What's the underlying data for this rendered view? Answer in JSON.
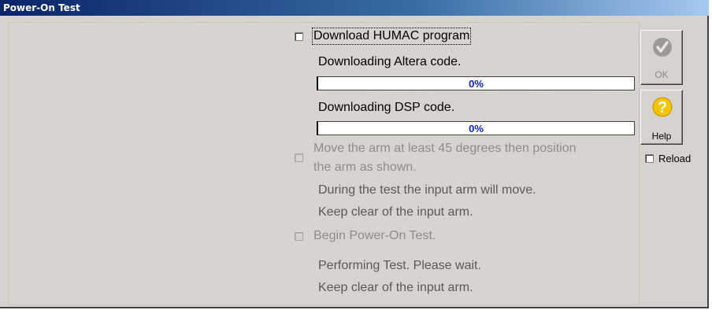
{
  "window": {
    "title": "Power-On Test"
  },
  "steps": {
    "download": {
      "checkbox_label": "Download HUMAC program",
      "altera_label": "Downloading Altera code.",
      "altera_progress": "0%",
      "altera_progress_value": 0,
      "dsp_label": "Downloading DSP code.",
      "dsp_progress": "0%",
      "dsp_progress_value": 0
    },
    "position": {
      "label_line1": "Move the arm at least 45 degrees then position",
      "label_line2": "the arm as shown.",
      "info_line1": "During the test the input arm will move.",
      "info_line2": "Keep clear of the input arm."
    },
    "begin": {
      "label": "Begin Power-On Test.",
      "info_line1": "Performing Test. Please wait.",
      "info_line2": "Keep clear of the input arm."
    }
  },
  "buttons": {
    "ok_label": "OK",
    "help_label": "Help",
    "reload_label": "Reload"
  },
  "colors": {
    "titlebar": "#0a246a",
    "progress_text": "#0a1dbe",
    "help_icon": "#f5c400"
  }
}
